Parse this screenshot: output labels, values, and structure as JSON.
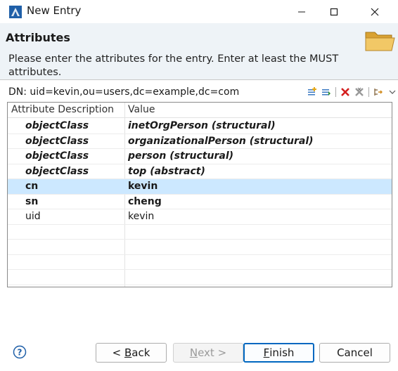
{
  "window": {
    "title": "New Entry",
    "icon": "ldap-app-icon"
  },
  "header": {
    "title": "Attributes",
    "description": "Please enter the attributes for the entry. Enter at least the MUST attributes.",
    "icon": "folder-icon"
  },
  "dn": {
    "text": "DN: uid=kevin,ou=users,dc=example,dc=com"
  },
  "toolbar": {
    "icons": [
      "new-attribute-icon",
      "new-value-icon",
      "delete-icon",
      "delete-all-icon",
      "expand-icon",
      "menu-dropdown-icon"
    ]
  },
  "table": {
    "columns": [
      "Attribute Description",
      "Value"
    ],
    "rows": [
      {
        "attribute": "objectClass",
        "value": "inetOrgPerson (structural)",
        "style": "italic"
      },
      {
        "attribute": "objectClass",
        "value": "organizationalPerson (structural)",
        "style": "italic"
      },
      {
        "attribute": "objectClass",
        "value": "person (structural)",
        "style": "italic"
      },
      {
        "attribute": "objectClass",
        "value": "top (abstract)",
        "style": "italic"
      },
      {
        "attribute": "cn",
        "value": "kevin",
        "style": "bold",
        "selected": true
      },
      {
        "attribute": "sn",
        "value": "cheng",
        "style": "bold"
      },
      {
        "attribute": "uid",
        "value": "kevin",
        "style": "normal"
      }
    ]
  },
  "buttons": {
    "back_prefix": "< ",
    "back_key": "B",
    "back_rest": "ack",
    "next_key": "N",
    "next_rest": "ext >",
    "finish_key": "F",
    "finish_rest": "inish",
    "cancel": "Cancel"
  },
  "colors": {
    "header_bg": "#eef3f7",
    "selection": "#cce8ff",
    "accent": "#0067c0"
  }
}
